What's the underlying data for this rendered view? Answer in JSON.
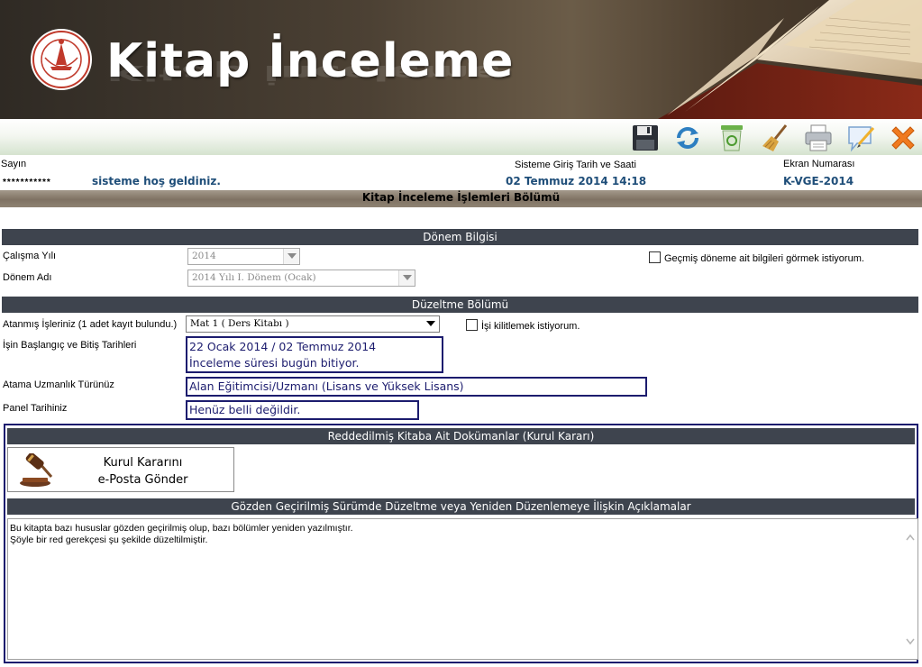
{
  "banner": {
    "title": "Kitap İnceleme",
    "logo_text": "T.C. MİLLİ EĞİTİM BAKANLIĞI"
  },
  "toolbar": {
    "icons": [
      "save-icon",
      "refresh-icon",
      "recycle-bin-icon",
      "broom-icon",
      "print-icon",
      "comment-edit-icon",
      "close-icon"
    ]
  },
  "header": {
    "greeting_label": "Sayın",
    "user_name": "***********",
    "welcome": "sisteme hoş geldiniz.",
    "login_label": "Sisteme Giriş Tarih ve Saati",
    "login_value": "02 Temmuz 2014 14:18",
    "screen_label": "Ekran Numarası",
    "screen_value": "K-VGE-2014"
  },
  "main_title": "Kitap İnceleme İşlemleri Bölümü",
  "donem": {
    "title": "Dönem Bilgisi",
    "year_label": "Çalışma Yılı",
    "year_value": "2014",
    "period_label": "Dönem Adı",
    "period_value": "2014 Yılı I. Dönem (Ocak)",
    "past_checkbox_label": "Geçmiş döneme ait bilgileri görmek istiyorum."
  },
  "duzeltme": {
    "title": "Düzeltme Bölümü",
    "assigned_label": "Atanmış İşleriniz (1 adet kayıt bulundu.)",
    "assigned_value": "Mat 1 ( Ders Kitabı )",
    "lock_checkbox_label": "İşi kilitlemek istiyorum.",
    "dates_label": "İşin Başlangıç ve Bitiş Tarihleri",
    "dates_line1": "22 Ocak 2014 / 02 Temmuz 2014",
    "dates_line2": "İnceleme süresi bugün bitiyor.",
    "expertise_label": "Atama Uzmanlık Türünüz",
    "expertise_value": "Alan Eğitimcisi/Uzmanı (Lisans ve Yüksek Lisans)",
    "panel_label": "Panel Tarihiniz",
    "panel_value": "Henüz belli değildir."
  },
  "rejected": {
    "title": "Reddedilmiş Kitaba Ait Dokümanlar (Kurul Kararı)",
    "button_line1": "Kurul Kararını",
    "button_line2": "e-Posta Gönder"
  },
  "explanations": {
    "title": "Gözden Geçirilmiş Sürümde Düzeltme veya Yeniden Düzenlemeye İlişkin Açıklamalar",
    "line1": "Bu kitapta bazı hususlar gözden geçirilmiş olup, bazı bölümler yeniden yazılmıştır.",
    "line2": "Şöyle bir red gerekçesi şu şekilde düzeltilmiştir."
  },
  "colors": {
    "section_bar": "#3e444e",
    "info_border": "#1c1c6e",
    "header_value": "#1f4e79"
  }
}
